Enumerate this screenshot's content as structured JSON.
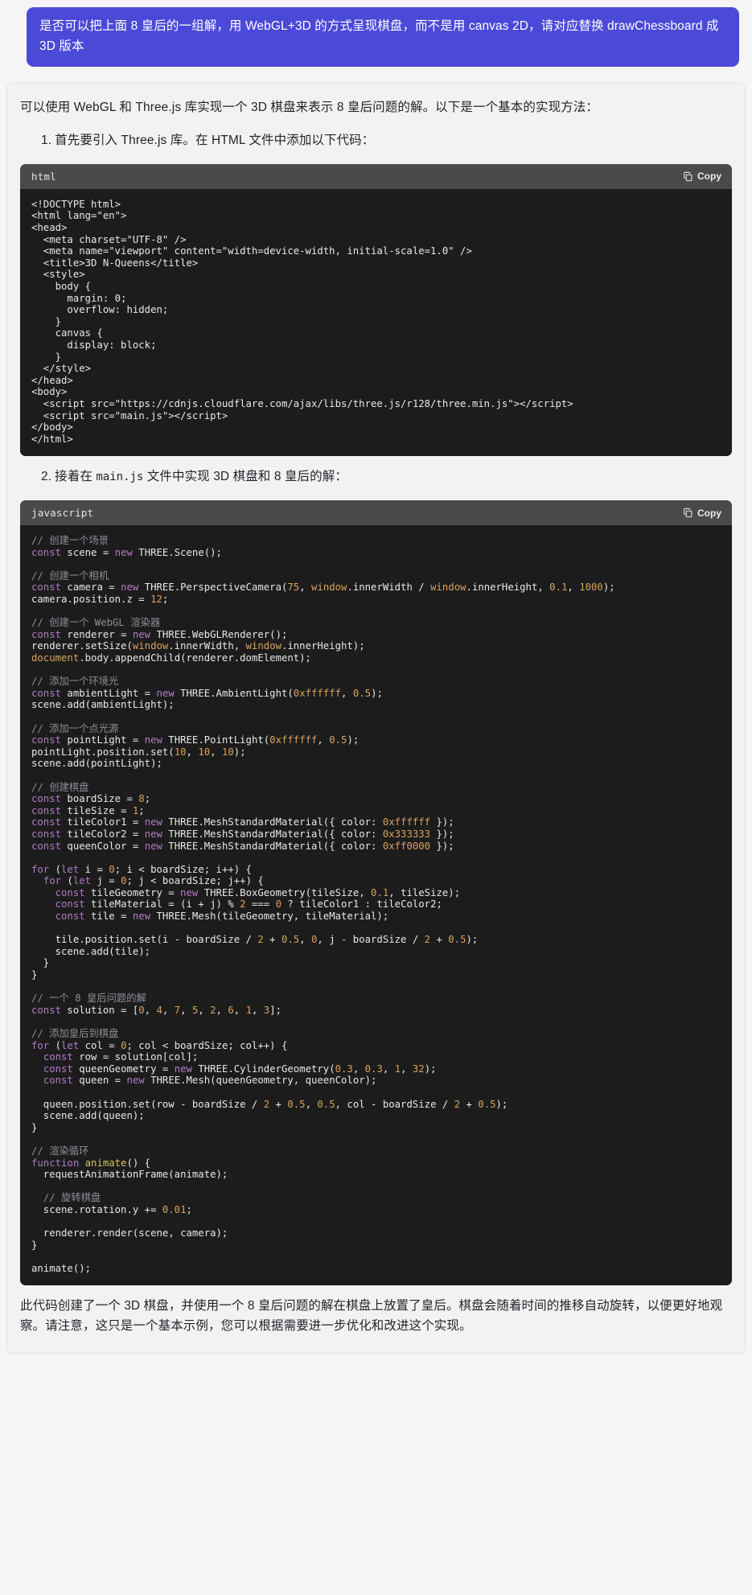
{
  "theme": {
    "page_bg": "#f5f5f5",
    "user_bubble_bg": "#4b49d8",
    "assistant_bg": "#f2f2f2",
    "code_bg": "#1c1c1c",
    "code_header_bg": "#4a4a4a",
    "token_comment": "#8a8f98",
    "token_keyword": "#b07cc6",
    "token_number": "#d8a35f",
    "token_function": "#d8c45f"
  },
  "user_message": {
    "text": "是否可以把上面 8 皇后的一组解，用 WebGL+3D 的方式呈现棋盘，而不是用 canvas 2D，请对应替换 drawChessboard 成 3D 版本"
  },
  "assistant": {
    "intro": "可以使用 WebGL 和 Three.js 库实现一个 3D 棋盘来表示 8 皇后问题的解。以下是一个基本的实现方法：",
    "step1": {
      "number": "1.",
      "text": "首先要引入 Three.js 库。在 HTML 文件中添加以下代码："
    },
    "step2": {
      "number": "2.",
      "prefix": "接着在 ",
      "code": "main.js",
      "suffix": " 文件中实现 3D 棋盘和 8 皇后的解："
    },
    "outro": "此代码创建了一个 3D 棋盘，并使用一个 8 皇后问题的解在棋盘上放置了皇后。棋盘会随着时间的推移自动旋转，以便更好地观察。请注意，这只是一个基本示例，您可以根据需要进一步优化和改进这个实现。"
  },
  "code_blocks": [
    {
      "language": "html",
      "copy_label": "Copy",
      "copy_icon": "copy-icon",
      "code": "<!DOCTYPE html>\n<html lang=\"en\">\n<head>\n  <meta charset=\"UTF-8\" />\n  <meta name=\"viewport\" content=\"width=device-width, initial-scale=1.0\" />\n  <title>3D N-Queens</title>\n  <style>\n    body {\n      margin: 0;\n      overflow: hidden;\n    }\n    canvas {\n      display: block;\n    }\n  </style>\n</head>\n<body>\n  <script src=\"https://cdnjs.cloudflare.com/ajax/libs/three.js/r128/three.min.js\"></script>\n  <script src=\"main.js\"></script>\n</body>\n</html>"
    },
    {
      "language": "javascript",
      "copy_label": "Copy",
      "copy_icon": "copy-icon",
      "code": "// 创建一个场景\nconst scene = new THREE.Scene();\n\n// 创建一个相机\nconst camera = new THREE.PerspectiveCamera(75, window.innerWidth / window.innerHeight, 0.1, 1000);\ncamera.position.z = 12;\n\n// 创建一个 WebGL 渲染器\nconst renderer = new THREE.WebGLRenderer();\nrenderer.setSize(window.innerWidth, window.innerHeight);\ndocument.body.appendChild(renderer.domElement);\n\n// 添加一个环境光\nconst ambientLight = new THREE.AmbientLight(0xffffff, 0.5);\nscene.add(ambientLight);\n\n// 添加一个点光源\nconst pointLight = new THREE.PointLight(0xffffff, 0.5);\npointLight.position.set(10, 10, 10);\nscene.add(pointLight);\n\n// 创建棋盘\nconst boardSize = 8;\nconst tileSize = 1;\nconst tileColor1 = new THREE.MeshStandardMaterial({ color: 0xffffff });\nconst tileColor2 = new THREE.MeshStandardMaterial({ color: 0x333333 });\nconst queenColor = new THREE.MeshStandardMaterial({ color: 0xff0000 });\n\nfor (let i = 0; i < boardSize; i++) {\n  for (let j = 0; j < boardSize; j++) {\n    const tileGeometry = new THREE.BoxGeometry(tileSize, 0.1, tileSize);\n    const tileMaterial = (i + j) % 2 === 0 ? tileColor1 : tileColor2;\n    const tile = new THREE.Mesh(tileGeometry, tileMaterial);\n\n    tile.position.set(i - boardSize / 2 + 0.5, 0, j - boardSize / 2 + 0.5);\n    scene.add(tile);\n  }\n}\n\n// 一个 8 皇后问题的解\nconst solution = [0, 4, 7, 5, 2, 6, 1, 3];\n\n// 添加皇后到棋盘\nfor (let col = 0; col < boardSize; col++) {\n  const row = solution[col];\n  const queenGeometry = new THREE.CylinderGeometry(0.3, 0.3, 1, 32);\n  const queen = new THREE.Mesh(queenGeometry, queenColor);\n\n  queen.position.set(row - boardSize / 2 + 0.5, 0.5, col - boardSize / 2 + 0.5);\n  scene.add(queen);\n}\n\n// 渲染循环\nfunction animate() {\n  requestAnimationFrame(animate);\n\n  // 旋转棋盘\n  scene.rotation.y += 0.01;\n\n  renderer.render(scene, camera);\n}\n\nanimate();"
    }
  ]
}
